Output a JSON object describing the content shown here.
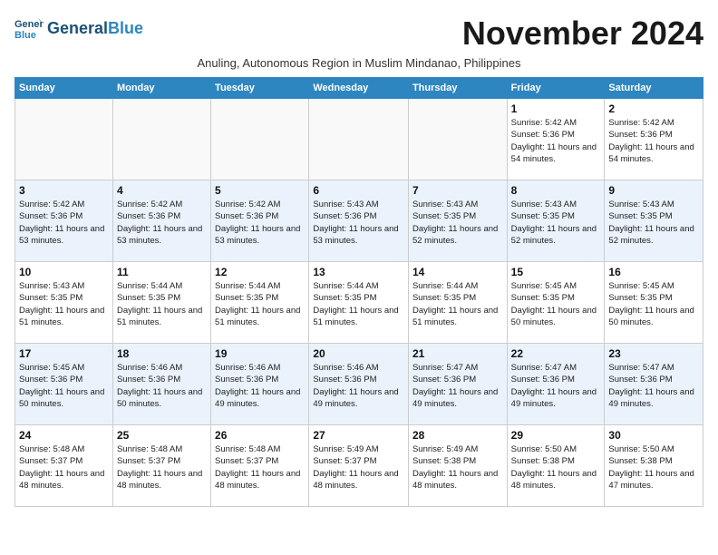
{
  "header": {
    "logo_line1": "General",
    "logo_line2": "Blue",
    "month_title": "November 2024",
    "subtitle": "Anuling, Autonomous Region in Muslim Mindanao, Philippines"
  },
  "days_of_week": [
    "Sunday",
    "Monday",
    "Tuesday",
    "Wednesday",
    "Thursday",
    "Friday",
    "Saturday"
  ],
  "weeks": [
    [
      {
        "day": "",
        "info": ""
      },
      {
        "day": "",
        "info": ""
      },
      {
        "day": "",
        "info": ""
      },
      {
        "day": "",
        "info": ""
      },
      {
        "day": "",
        "info": ""
      },
      {
        "day": "1",
        "info": "Sunrise: 5:42 AM\nSunset: 5:36 PM\nDaylight: 11 hours and 54 minutes."
      },
      {
        "day": "2",
        "info": "Sunrise: 5:42 AM\nSunset: 5:36 PM\nDaylight: 11 hours and 54 minutes."
      }
    ],
    [
      {
        "day": "3",
        "info": "Sunrise: 5:42 AM\nSunset: 5:36 PM\nDaylight: 11 hours and 53 minutes."
      },
      {
        "day": "4",
        "info": "Sunrise: 5:42 AM\nSunset: 5:36 PM\nDaylight: 11 hours and 53 minutes."
      },
      {
        "day": "5",
        "info": "Sunrise: 5:42 AM\nSunset: 5:36 PM\nDaylight: 11 hours and 53 minutes."
      },
      {
        "day": "6",
        "info": "Sunrise: 5:43 AM\nSunset: 5:36 PM\nDaylight: 11 hours and 53 minutes."
      },
      {
        "day": "7",
        "info": "Sunrise: 5:43 AM\nSunset: 5:35 PM\nDaylight: 11 hours and 52 minutes."
      },
      {
        "day": "8",
        "info": "Sunrise: 5:43 AM\nSunset: 5:35 PM\nDaylight: 11 hours and 52 minutes."
      },
      {
        "day": "9",
        "info": "Sunrise: 5:43 AM\nSunset: 5:35 PM\nDaylight: 11 hours and 52 minutes."
      }
    ],
    [
      {
        "day": "10",
        "info": "Sunrise: 5:43 AM\nSunset: 5:35 PM\nDaylight: 11 hours and 51 minutes."
      },
      {
        "day": "11",
        "info": "Sunrise: 5:44 AM\nSunset: 5:35 PM\nDaylight: 11 hours and 51 minutes."
      },
      {
        "day": "12",
        "info": "Sunrise: 5:44 AM\nSunset: 5:35 PM\nDaylight: 11 hours and 51 minutes."
      },
      {
        "day": "13",
        "info": "Sunrise: 5:44 AM\nSunset: 5:35 PM\nDaylight: 11 hours and 51 minutes."
      },
      {
        "day": "14",
        "info": "Sunrise: 5:44 AM\nSunset: 5:35 PM\nDaylight: 11 hours and 51 minutes."
      },
      {
        "day": "15",
        "info": "Sunrise: 5:45 AM\nSunset: 5:35 PM\nDaylight: 11 hours and 50 minutes."
      },
      {
        "day": "16",
        "info": "Sunrise: 5:45 AM\nSunset: 5:35 PM\nDaylight: 11 hours and 50 minutes."
      }
    ],
    [
      {
        "day": "17",
        "info": "Sunrise: 5:45 AM\nSunset: 5:36 PM\nDaylight: 11 hours and 50 minutes."
      },
      {
        "day": "18",
        "info": "Sunrise: 5:46 AM\nSunset: 5:36 PM\nDaylight: 11 hours and 50 minutes."
      },
      {
        "day": "19",
        "info": "Sunrise: 5:46 AM\nSunset: 5:36 PM\nDaylight: 11 hours and 49 minutes."
      },
      {
        "day": "20",
        "info": "Sunrise: 5:46 AM\nSunset: 5:36 PM\nDaylight: 11 hours and 49 minutes."
      },
      {
        "day": "21",
        "info": "Sunrise: 5:47 AM\nSunset: 5:36 PM\nDaylight: 11 hours and 49 minutes."
      },
      {
        "day": "22",
        "info": "Sunrise: 5:47 AM\nSunset: 5:36 PM\nDaylight: 11 hours and 49 minutes."
      },
      {
        "day": "23",
        "info": "Sunrise: 5:47 AM\nSunset: 5:36 PM\nDaylight: 11 hours and 49 minutes."
      }
    ],
    [
      {
        "day": "24",
        "info": "Sunrise: 5:48 AM\nSunset: 5:37 PM\nDaylight: 11 hours and 48 minutes."
      },
      {
        "day": "25",
        "info": "Sunrise: 5:48 AM\nSunset: 5:37 PM\nDaylight: 11 hours and 48 minutes."
      },
      {
        "day": "26",
        "info": "Sunrise: 5:48 AM\nSunset: 5:37 PM\nDaylight: 11 hours and 48 minutes."
      },
      {
        "day": "27",
        "info": "Sunrise: 5:49 AM\nSunset: 5:37 PM\nDaylight: 11 hours and 48 minutes."
      },
      {
        "day": "28",
        "info": "Sunrise: 5:49 AM\nSunset: 5:38 PM\nDaylight: 11 hours and 48 minutes."
      },
      {
        "day": "29",
        "info": "Sunrise: 5:50 AM\nSunset: 5:38 PM\nDaylight: 11 hours and 48 minutes."
      },
      {
        "day": "30",
        "info": "Sunrise: 5:50 AM\nSunset: 5:38 PM\nDaylight: 11 hours and 47 minutes."
      }
    ]
  ]
}
